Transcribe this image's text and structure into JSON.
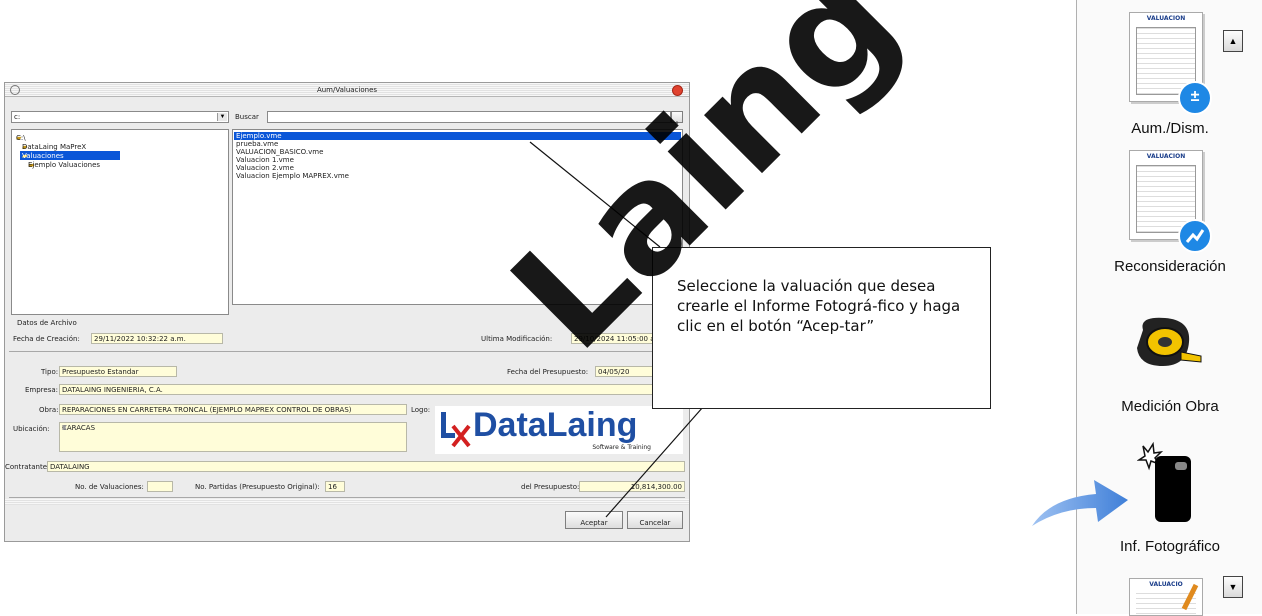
{
  "dialog": {
    "title": "Aum/Valuaciones",
    "drive_combo": "c:",
    "search_label": "Buscar",
    "folders": [
      "C:\\",
      "DataLaing MaPreX",
      "Valuaciones",
      "Ejemplo Valuaciones"
    ],
    "files": [
      "Ejemplo.vme",
      "prueba.vme",
      "VALUACION_BASICO.vme",
      "Valuacion 1.vme",
      "Valuacion 2.vme",
      "Valuacion Ejemplo MAPREX.vme"
    ],
    "archive_group": "Datos de Archivo",
    "created_label": "Fecha de Creación:",
    "created_value": "29/11/2022 10:32:22 a.m.",
    "modified_label": "Ultima Modificación:",
    "modified_value": "29/10/2024 11:05:00 a.",
    "tipo_label": "Tipo:",
    "tipo_value": "Presupuesto Estandar",
    "fecha_presupuesto_label": "Fecha del Presupuesto:",
    "fecha_presupuesto_value": "04/05/20",
    "empresa_label": "Empresa:",
    "empresa_value": "DATALAING INGENIERIA, C.A.",
    "obra_label": "Obra:",
    "obra_value": "REPARACIONES EN CARRETERA TRONCAL (EJEMPLO MAPREX CONTROL DE OBRAS)",
    "logo_label": "Logo:",
    "ubicacion_label": "Ubicación:",
    "ubicacion_value": "CARACAS",
    "contratante_label": "Contratante:",
    "contratante_value": "DATALAING",
    "num_valuaciones_label": "No. de Valuaciones:",
    "num_valuaciones_value": "",
    "num_partidas_label": "No. Partidas (Presupuesto Original):",
    "num_partidas_value": "16",
    "total_label": "del Presupuesto:",
    "total_value": "10,814,300.00",
    "accept_label": "Aceptar",
    "cancel_label": "Cancelar",
    "logo": {
      "brand": "DataLaing",
      "tagline": "Software & Training"
    }
  },
  "callout": {
    "text": "Seleccione la valuación que desea crearle el Informe Fotográ-fico y haga clic en el botón “Acep-tar”"
  },
  "toolbar": {
    "items": [
      {
        "label": "Aum./Dism.",
        "icon": "valuation-doc-plus-icon",
        "doc_title": "VALUACION"
      },
      {
        "label": "Reconsideración",
        "icon": "valuation-doc-chart-icon",
        "doc_title": "VALUACION"
      },
      {
        "label": "Medición Obra",
        "icon": "tape-measure-icon"
      },
      {
        "label": "Inf. Fotográfico",
        "icon": "phone-camera-icon"
      }
    ],
    "bottom_doc_title": "VALUACIO"
  },
  "watermark": "Laing",
  "colors": {
    "selection": "#0a56d8",
    "field_bg": "#fffdd9",
    "badge_blue": "#1e88e5",
    "logo_blue": "#1f4fa3",
    "logo_red": "#d32020"
  }
}
